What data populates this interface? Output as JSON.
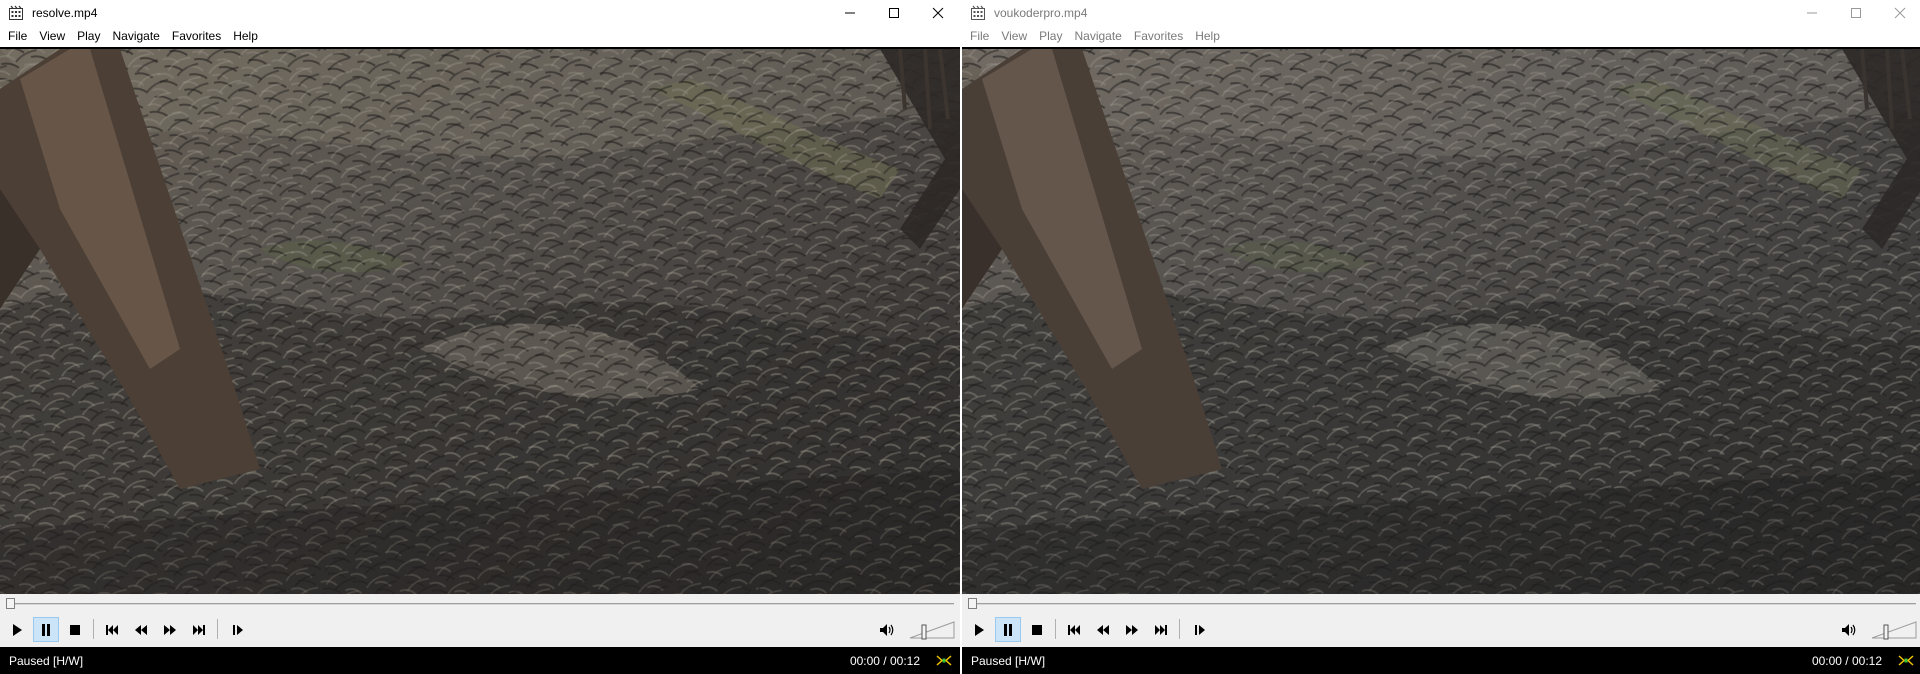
{
  "players": [
    {
      "title": "resolve.mp4",
      "menu": [
        "File",
        "View",
        "Play",
        "Navigate",
        "Favorites",
        "Help"
      ],
      "status": "Paused [H/W]",
      "time": "00:00 / 00:12",
      "playback_progress": 0,
      "active_control": "pause",
      "window_active": true
    },
    {
      "title": "voukoderpro.mp4",
      "menu": [
        "File",
        "View",
        "Play",
        "Navigate",
        "Favorites",
        "Help"
      ],
      "status": "Paused [H/W]",
      "time": "00:00 / 00:12",
      "playback_progress": 0,
      "active_control": "pause",
      "window_active": false
    }
  ],
  "icons": {
    "app": "media-player-icon",
    "minimize": "minimize-icon",
    "maximize": "maximize-icon",
    "close": "close-icon",
    "controls": [
      "play-icon",
      "pause-icon",
      "stop-icon",
      "skip-back-icon",
      "rewind-icon",
      "fast-forward-icon",
      "skip-forward-icon",
      "frame-step-icon",
      "volume-icon"
    ]
  },
  "colors": {
    "control_active": "#cce4f7",
    "status_bar": "#000000",
    "chrome": "#f0f0f0"
  }
}
